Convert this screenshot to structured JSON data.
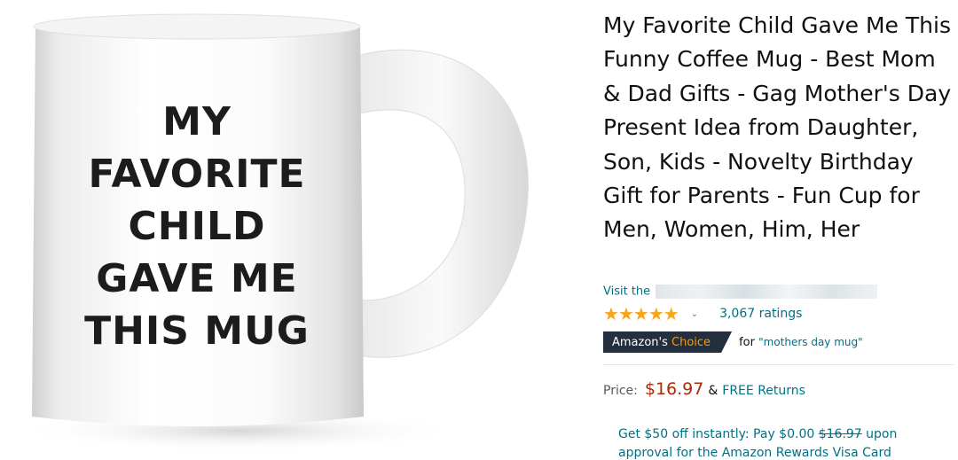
{
  "product": {
    "image": {
      "mug_text_lines": [
        "MY",
        "FAVORITE",
        "CHILD",
        "GAVE ME",
        "THIS MUG"
      ]
    },
    "title": "My Favorite Child Gave Me This Funny Coffee Mug - Best Mom & Dad Gifts - Gag Mother's Day Present Idea from Daughter, Son, Kids - Novelty Birthday Gift for Parents - Fun Cup for Men, Women, Him, Her",
    "store_link_prefix": "Visit the",
    "rating": {
      "stars": 4.5,
      "ratings_count": "3,067 ratings"
    },
    "badge": {
      "brand": "Amazon's",
      "label": "Choice",
      "for_text": "for",
      "query": "\"mothers day mug\""
    },
    "price": {
      "label": "Price:",
      "amount": "$16.97",
      "ampersand": "&",
      "returns": "FREE Returns"
    },
    "promo": {
      "prefix": "Get $50 off instantly: Pay $0.00",
      "original_price": "$16.97",
      "suffix": "upon",
      "next_line": "approval for the Amazon Rewards Visa Card"
    }
  },
  "colors": {
    "link": "#007185",
    "price": "#B12704",
    "star": "#F8A51C",
    "badge_bg": "#232F3E",
    "badge_accent": "#FF9900"
  }
}
